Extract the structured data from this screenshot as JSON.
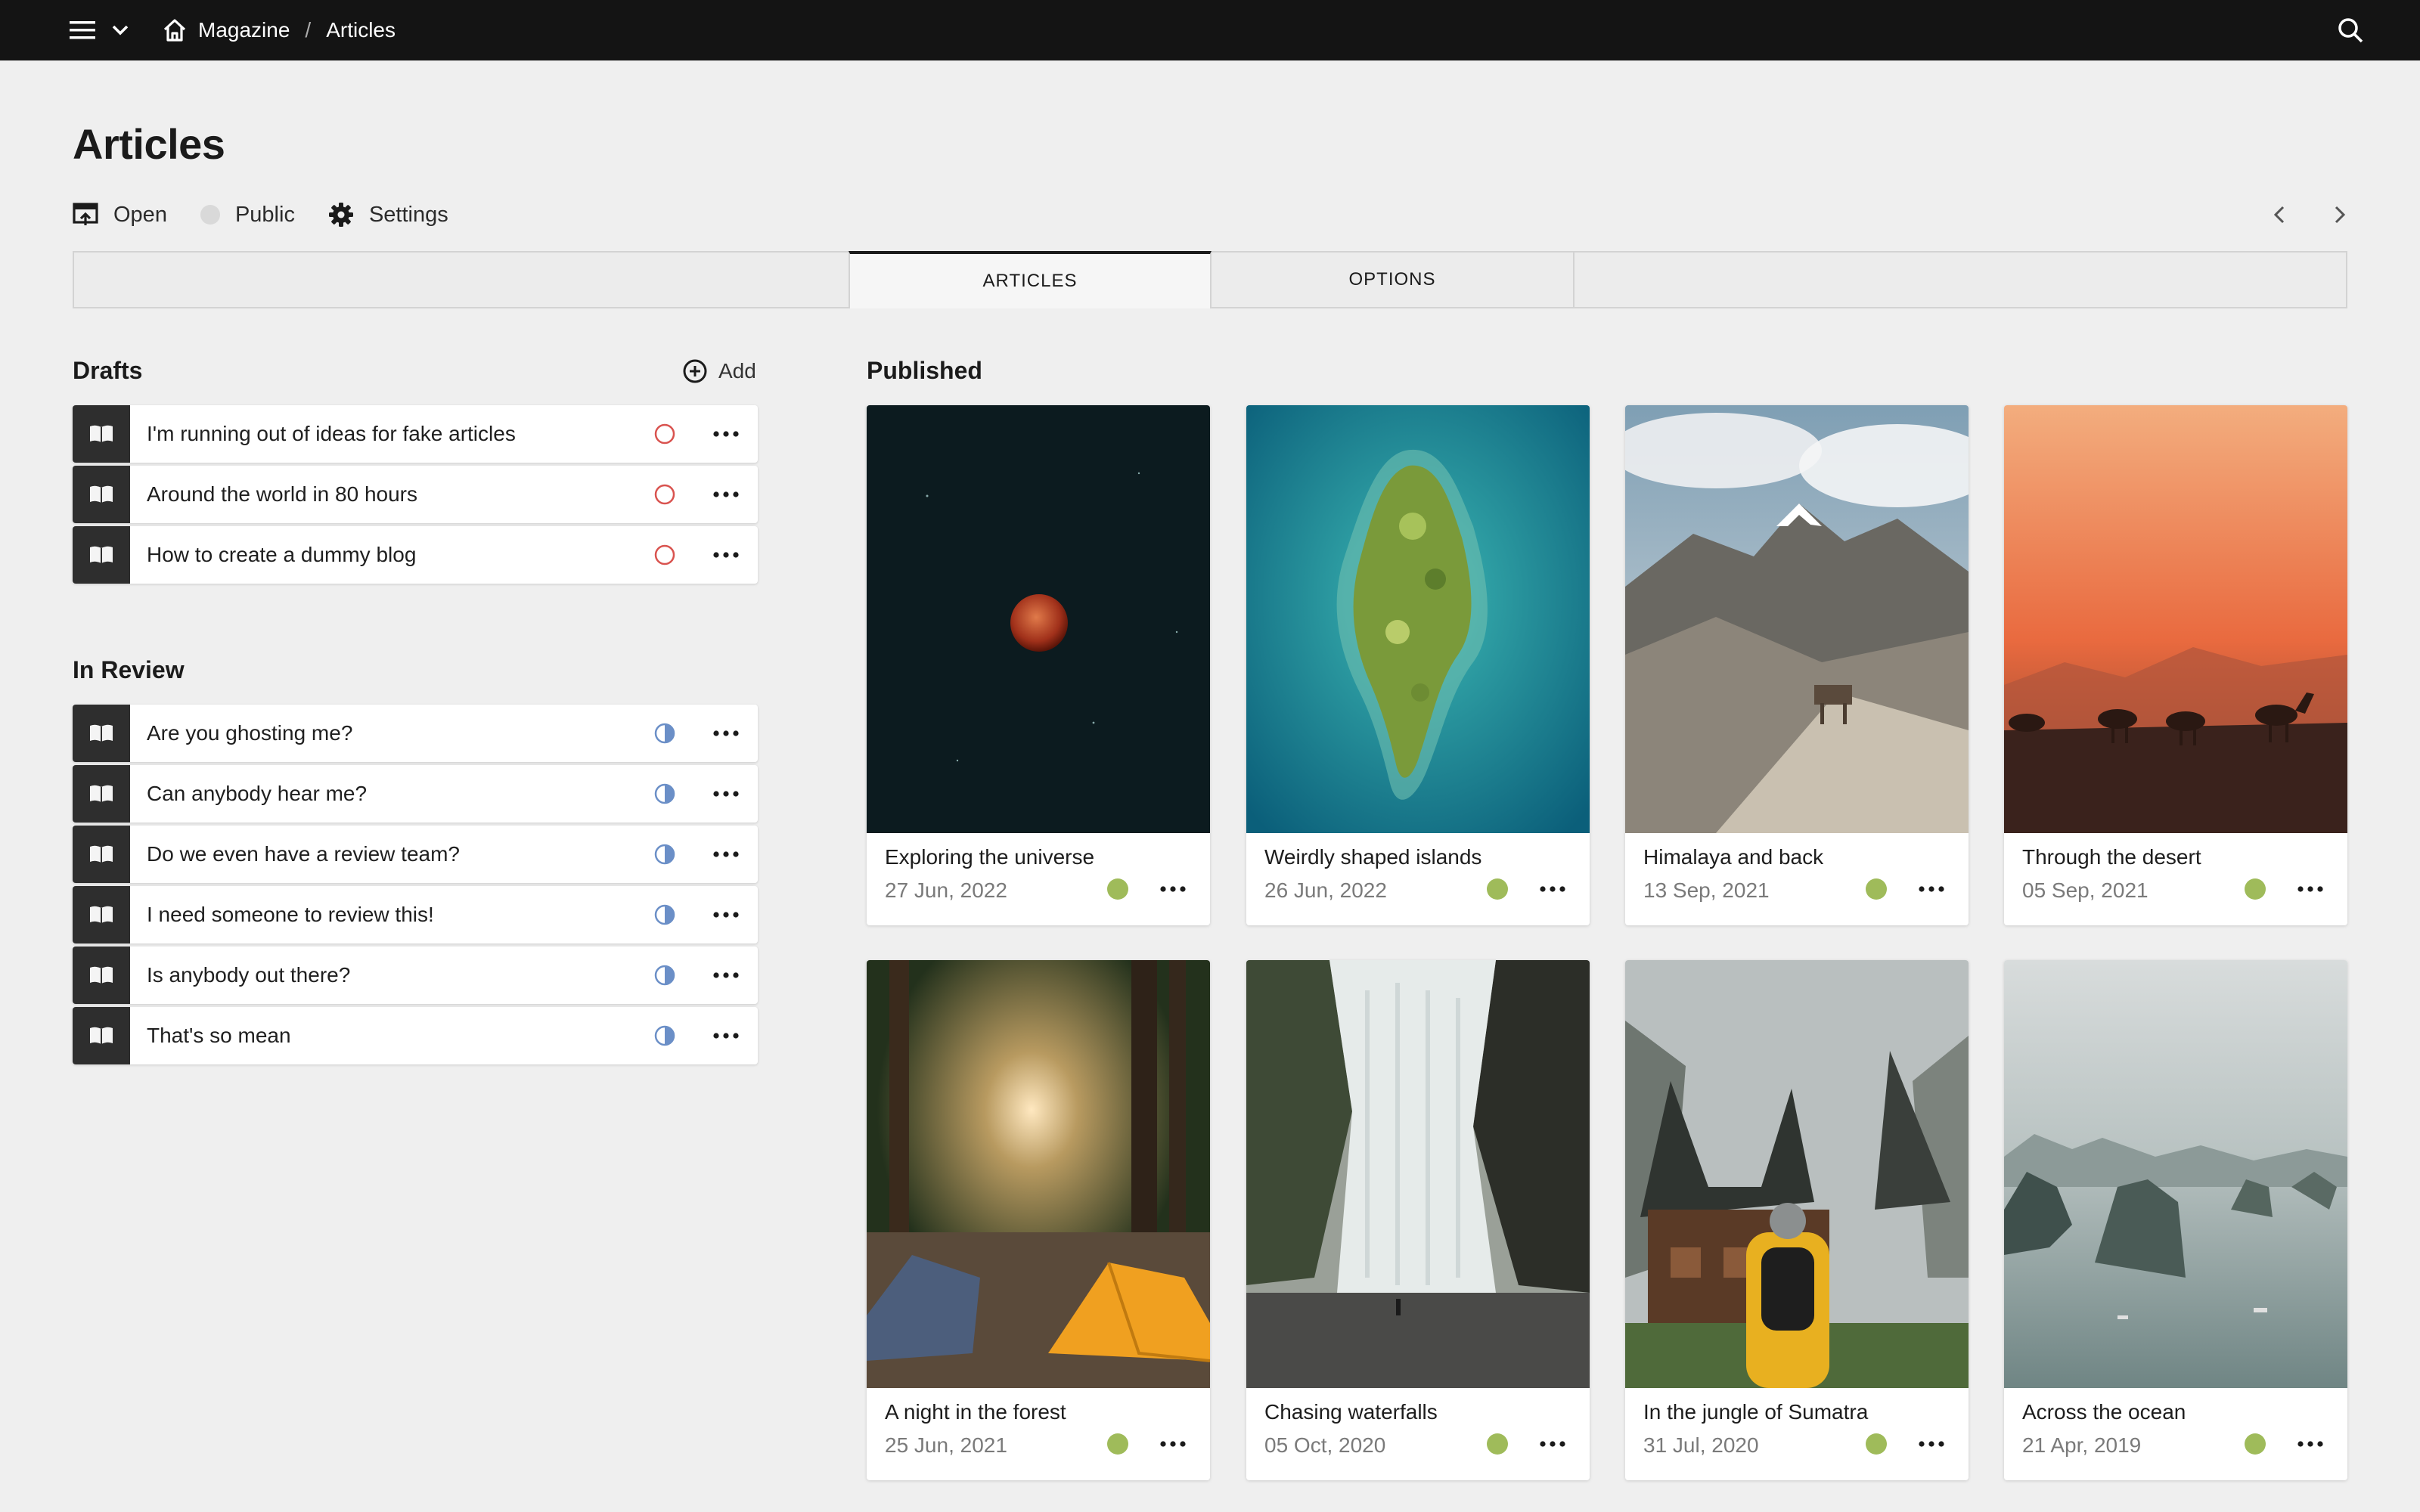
{
  "topbar": {
    "breadcrumb": [
      "Magazine",
      "Articles"
    ],
    "separator": "/"
  },
  "page": {
    "title": "Articles",
    "actions": {
      "open": "Open",
      "public": "Public",
      "settings": "Settings"
    }
  },
  "tabs": [
    "ARTICLES",
    "OPTIONS"
  ],
  "drafts": {
    "title": "Drafts",
    "add_label": "Add",
    "items": [
      "I'm running out of ideas for fake articles",
      "Around the world in 80 hours",
      "How to create a dummy blog"
    ]
  },
  "review": {
    "title": "In Review",
    "items": [
      "Are you ghosting me?",
      "Can anybody hear me?",
      "Do we even have a review team?",
      "I need someone to review this!",
      "Is anybody out there?",
      "That's so mean"
    ]
  },
  "published": {
    "title": "Published",
    "cards": [
      {
        "title": "Exploring the universe",
        "date": "27 Jun, 2022"
      },
      {
        "title": "Weirdly shaped islands",
        "date": "26 Jun, 2022"
      },
      {
        "title": "Himalaya and back",
        "date": "13 Sep, 2021"
      },
      {
        "title": "Through the desert",
        "date": "05 Sep, 2021"
      },
      {
        "title": "A night in the forest",
        "date": "25 Jun, 2021"
      },
      {
        "title": "Chasing waterfalls",
        "date": "05 Oct, 2020"
      },
      {
        "title": "In the jungle of Sumatra",
        "date": "31 Jul, 2020"
      },
      {
        "title": "Across the ocean",
        "date": "21 Apr, 2019"
      }
    ]
  },
  "colors": {
    "topbar": "#141414",
    "background": "#efefef",
    "draft_status": "#d9534f",
    "review_status": "#6b8fc7",
    "published_status": "#9fbb5a"
  }
}
